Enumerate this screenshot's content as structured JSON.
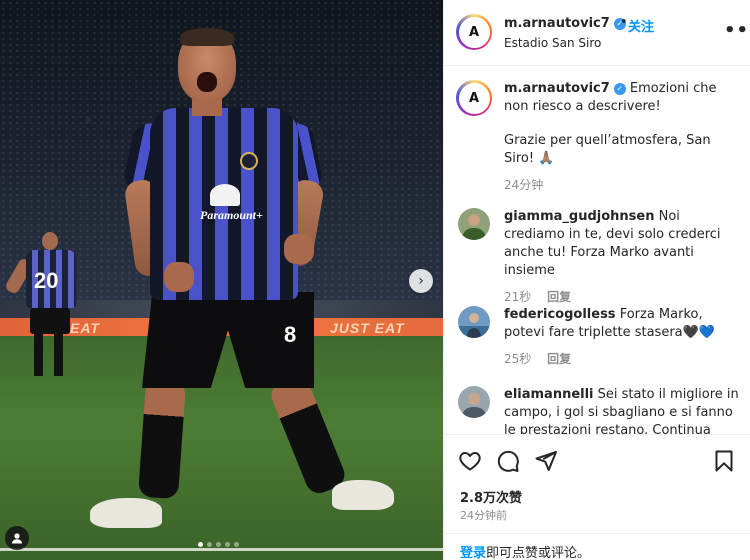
{
  "photo": {
    "ad_left": "EAT",
    "ad_right": "JUST EAT",
    "sponsor": "Paramount+",
    "bg_player_number": "20",
    "player_number": "8",
    "carousel": {
      "count": 5,
      "active": 0
    },
    "next_icon": "chevron-right-icon",
    "user_tag_icon": "person-icon"
  },
  "header": {
    "username": "m.arnautovic7",
    "separator": "•",
    "follow_label": "关注",
    "location": "Estadio San Siro",
    "more_icon": "•••"
  },
  "caption": {
    "username": "m.arnautovic7",
    "text_line1": "Emozioni che non riesco a descrivere!",
    "text_line2": "Grazie per quell’atmosfera, San Siro! 🙏🏽",
    "time": "24分钟"
  },
  "comments": [
    {
      "username": "giamma_gudjohnsen",
      "text": "Noi crediamo in te, devi solo crederci anche tu! Forza Marko avanti insieme",
      "time": "21秒",
      "reply": "回复"
    },
    {
      "username": "federicogolless",
      "text": "Forza Marko, potevi fare triplette stasera🖤💙",
      "time": "25秒",
      "reply": "回复"
    },
    {
      "username": "eliamannelli",
      "text": "Sei stato il migliore in campo, i gol si sbagliano e si fanno le prestazioni restano. Continua così"
    }
  ],
  "actions": {
    "like_icon": "heart-icon",
    "comment_icon": "comment-icon",
    "share_icon": "paper-plane-icon",
    "save_icon": "bookmark-icon",
    "likes": "2.8万次赞",
    "time": "24分钟前",
    "login_link": "登录",
    "login_text": "即可点赞或评论。"
  },
  "colors": {
    "link": "#0095f6",
    "verified": "#3897f0",
    "muted": "#8e8e8e",
    "kit_blue": "#4a52c9",
    "kit_black": "#121829"
  }
}
